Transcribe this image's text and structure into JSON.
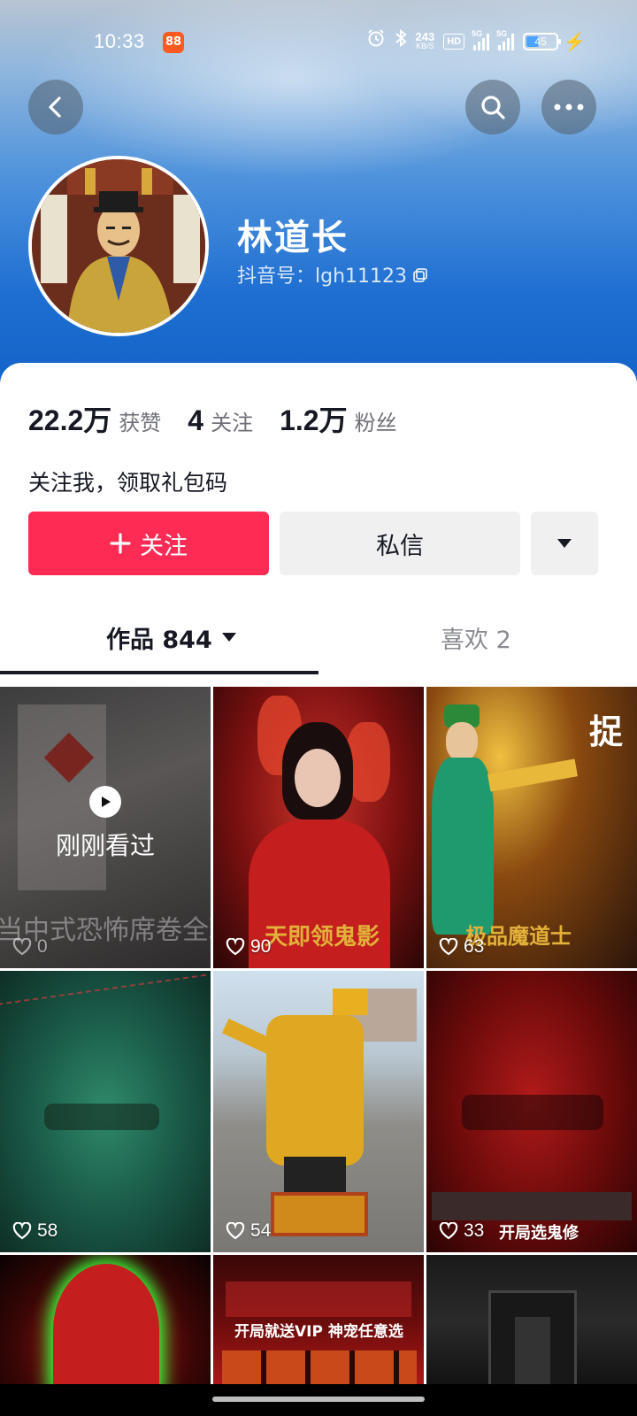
{
  "status_bar": {
    "time": "10:33",
    "app_badge": "88",
    "net_speed_value": "243",
    "net_speed_unit": "KB/S",
    "hd_label": "HD",
    "signal1_label": "5G",
    "signal2_label": "5G",
    "battery_percent": "45",
    "icons": [
      "alarm-icon",
      "bluetooth-icon",
      "charging-bolt-icon"
    ]
  },
  "profile": {
    "nickname": "林道长",
    "douyin_id": "抖音号：lgh11123",
    "bio": "关注我，领取礼包码"
  },
  "stats": [
    {
      "value": "22.2万",
      "label": "获赞"
    },
    {
      "value": "4",
      "label": "关注"
    },
    {
      "value": "1.2万",
      "label": "粉丝"
    }
  ],
  "actions": {
    "follow_label": "关注",
    "message_label": "私信"
  },
  "tabs": {
    "works_label": "作品 844",
    "likes_label": "喜欢 2"
  },
  "videos": [
    {
      "likes": "0",
      "watched_label": "刚刚看过",
      "caption": "当中式恐怖席卷全球"
    },
    {
      "likes": "90",
      "caption": "天即领鬼影"
    },
    {
      "likes": "63",
      "caption": "极品魔道士",
      "title_art": "捉"
    },
    {
      "likes": "58"
    },
    {
      "likes": "54"
    },
    {
      "likes": "33",
      "caption": "开局选鬼修"
    },
    {},
    {
      "caption": "开局就送VIP  神宠任意选"
    },
    {}
  ],
  "colors": {
    "accent": "#fe2c55",
    "primary_text": "#161823",
    "secondary_text": "#6f7078"
  }
}
